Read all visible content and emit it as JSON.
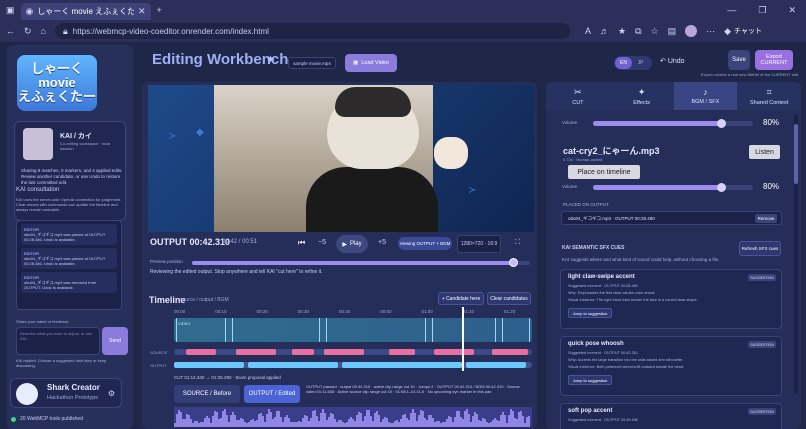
{
  "browser": {
    "tab_title": "しゃーく movie えふぇくたー - Editing",
    "new_tab": "+",
    "url": "https://webmcp-video-coeditor.onrender.com/index.html",
    "copilot_label": "チャット",
    "window_buttons": [
      "—",
      "❐",
      "✕"
    ]
  },
  "sidebar": {
    "logo_text": "しゃーく\nmovie\nえふぇくたー",
    "kai": {
      "name": "KAI / カイ",
      "subtitle": "Co-editing workspace · local session",
      "description": "Sharing 8 matches, 0 markers, and 4 applied edits. Review another candidate, or use Undo to restore the last committed edit."
    },
    "consult_title": "KAI consultation",
    "consult_info": "KAI uses the server-side OpenAI connection for judgement. Clear moves with commands can update the timeline and always remain undoable.",
    "log": [
      {
        "who": "EDITOR",
        "text": "otto04_ギコギコ.mp3 was placed at OUTPUT 00:28.480. Undo is available."
      },
      {
        "who": "EDITOR",
        "text": "otto04_ギコギコ.mp3 was placed at OUTPUT 00:28.480. Undo is available."
      },
      {
        "who": "EDITOR",
        "text": "otto04_ギコギコ.mp3 was removed from OUTPUT. Undo is available."
      }
    ],
    "prompt_label": "Share your intent or feedback",
    "prompt_placeholder": "Describe what you want to adjust, or ask KAI...",
    "send_label": "Send",
    "reply_note": "KAI replied. Choose a suggested next step or keep discussing.",
    "user": {
      "name": "Shark Creator",
      "subtitle": "Hackathon Prototype"
    },
    "tools_label": "20 WebMCP tools published"
  },
  "header": {
    "title": "Editing Workbench",
    "filename": "sample movie.mp4",
    "load_label": "Load Video",
    "lang_on": "EN",
    "lang_off": "JP",
    "undo_label": "Undo",
    "save_label": "Save",
    "export_label": "Export CURRENT",
    "export_note": "Export creates a real new WebM of the CURRENT edit"
  },
  "player": {
    "output_time": "OUTPUT 00:42.310",
    "duration": "00:42 / 00:51",
    "minus5": "−5",
    "play_label": "Play",
    "plus5": "+5",
    "viewing": "Viewing OUTPUT + BGM",
    "resolution": "1280×720 · 16:9",
    "preview_label": "Preview position",
    "preview_progress": 0.95,
    "review_text": "Reviewing the edited output. Stop anywhere and tell KAI \"cut here\" to refine it."
  },
  "timeline": {
    "title": "Timeline",
    "subtitle": "source / output / BGM",
    "candidate_label": "+ Candidate here",
    "clear_label": "Clear candidates",
    "ruler": [
      "00:00",
      "00:10",
      "00:20",
      "00:30",
      "00:40",
      "00:50",
      "01:00",
      "01:10",
      "01:20"
    ],
    "video_label": "VIDEO",
    "source_label": "SOURCE",
    "output_label": "OUTPUT",
    "cut_note": "CUT 01:14.340 → 01:25.290 · 8cam proposal applied",
    "src_btn": "SOURCE / Before",
    "out_btn": "OUTPUT / Edited",
    "prop_info": "OUTPUT paused · output 00:42.310 · active clip range cut 10 · Jumps 2 · OUTPUT 00:42.310 / BGM 00:42.310 · Source video 01:11.608 · Active source clip range cut 10 · 01:08.1–01:11.6 · No upcoming syn marker in this pan"
  },
  "right_panel": {
    "tabs": [
      {
        "icon": "✂",
        "label": "CUT"
      },
      {
        "icon": "✦",
        "label": "Effects"
      },
      {
        "icon": "♪",
        "label": "BGM / SFX"
      },
      {
        "icon": "⌗",
        "label": "Shared Context"
      }
    ],
    "active_tab": 2,
    "volume_label": "Volume",
    "volume_1": 0.8,
    "volume_1_text": "80%",
    "bgm_name": "cat-cry2_にゃーん.mp3",
    "bgm_sub": "0.72s · Human-owned",
    "listen_label": "Listen",
    "place_label": "Place on timeline",
    "volume_2": 0.8,
    "volume_2_text": "80%",
    "placed_label": "PLACED ON OUTPUT",
    "placed_item": "otto04_ギコギコ.mp3 · OUTPUT 00:28.480",
    "remove_label": "Remove",
    "semantic_title": "KAI SEMANTIC SFX CUES",
    "semantic_sub": "KAI suggests where and what kind of sound could help, without choosing a file.",
    "refresh_label": "Refresh SFX cues",
    "suggestions": [
      {
        "name": "light claw-swipe accent",
        "badge": "SUGGESTION",
        "moment": "Suggested moment · OUTPUT 00:28.480",
        "why": "Why: Emphasizes the first clear cat-like claw reveal.",
        "evidence": "Visual evidence: The right hand rises beside the face in a curved claw shape.",
        "jump_label": "Jump to suggestion"
      },
      {
        "name": "quick pose whoosh",
        "badge": "SUGGESTION",
        "moment": "Suggested moment · OUTPUT 00:42.310",
        "why": "Why: Accents the large transition into the wide-raised arm silhouette.",
        "evidence": "Visual evidence: Both patterned sleeves lift outward beside the head.",
        "jump_label": "Jump to suggestion"
      },
      {
        "name": "soft pop accent",
        "badge": "SUGGESTION",
        "moment": "Suggested moment · OUTPUT 00:49.496",
        "why": "",
        "evidence": "",
        "jump_label": ""
      }
    ]
  }
}
